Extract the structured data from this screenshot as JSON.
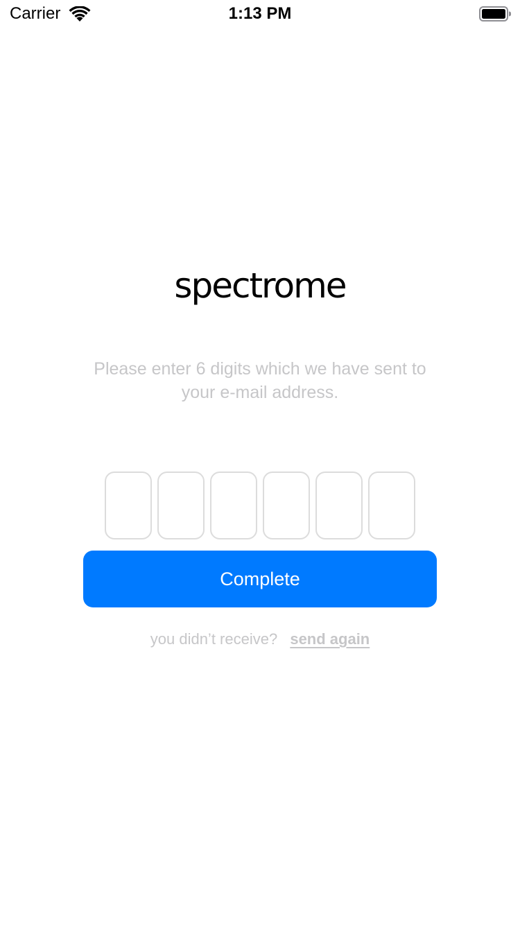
{
  "status_bar": {
    "carrier": "Carrier",
    "time": "1:13 PM",
    "wifi_icon": "wifi-icon",
    "battery_icon": "battery-full-icon"
  },
  "logo": {
    "text": "spectrome"
  },
  "instruction": {
    "text": "Please enter 6 digits which we have sent to your e-mail address."
  },
  "code_inputs": {
    "digits": [
      "",
      "",
      "",
      "",
      "",
      ""
    ]
  },
  "complete_button": {
    "label": "Complete",
    "color": "#007aff"
  },
  "resend": {
    "question": "you didn’t receive?",
    "link_label": "send again"
  }
}
